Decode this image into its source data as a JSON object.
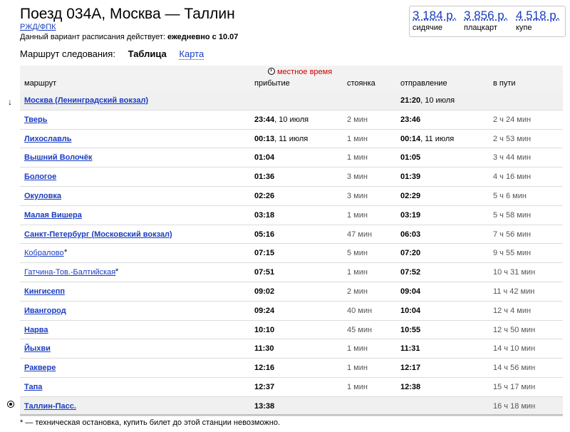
{
  "header": {
    "title": "Поезд 034А, Москва — Таллин",
    "carrier": "РЖД/ФПК",
    "validity_label": "Данный вариант расписания действует:",
    "validity_value": "ежедневно с 10.07"
  },
  "prices": [
    {
      "amount": "3 184 р.",
      "class": "сидячие"
    },
    {
      "amount": "3 856 р.",
      "class": "плацкарт"
    },
    {
      "amount": "4 518 р.",
      "class": "купе"
    }
  ],
  "route_view": {
    "label": "Маршрут следования:",
    "tab_table": "Таблица",
    "tab_map": "Карта"
  },
  "table": {
    "local_time_note": "местное время",
    "columns": {
      "route": "маршрут",
      "arrival": "прибытие",
      "stop": "стоянка",
      "departure": "отправление",
      "travel": "в пути"
    },
    "rows": [
      {
        "station": "Москва (Ленинградский вокзал)",
        "mark": "",
        "bold": true,
        "highlight": true,
        "arr_time": "",
        "arr_date": "",
        "stop": "",
        "dep_time": "21:20",
        "dep_date": ", 10 июля",
        "travel": ""
      },
      {
        "station": "Тверь",
        "mark": "",
        "bold": true,
        "highlight": false,
        "arr_time": "23:44",
        "arr_date": ", 10 июля",
        "stop": "2 мин",
        "dep_time": "23:46",
        "dep_date": "",
        "travel": "2 ч 24 мин"
      },
      {
        "station": "Лихославль",
        "mark": "",
        "bold": true,
        "highlight": false,
        "arr_time": "00:13",
        "arr_date": ", 11 июля",
        "stop": "1 мин",
        "dep_time": "00:14",
        "dep_date": ", 11 июля",
        "travel": "2 ч 53 мин"
      },
      {
        "station": "Вышний Волочёк",
        "mark": "",
        "bold": true,
        "highlight": false,
        "arr_time": "01:04",
        "arr_date": "",
        "stop": "1 мин",
        "dep_time": "01:05",
        "dep_date": "",
        "travel": "3 ч 44 мин"
      },
      {
        "station": "Бологое",
        "mark": "",
        "bold": true,
        "highlight": false,
        "arr_time": "01:36",
        "arr_date": "",
        "stop": "3 мин",
        "dep_time": "01:39",
        "dep_date": "",
        "travel": "4 ч 16 мин"
      },
      {
        "station": "Окуловка",
        "mark": "",
        "bold": true,
        "highlight": false,
        "arr_time": "02:26",
        "arr_date": "",
        "stop": "3 мин",
        "dep_time": "02:29",
        "dep_date": "",
        "travel": "5 ч 6 мин"
      },
      {
        "station": "Малая Вишера",
        "mark": "",
        "bold": true,
        "highlight": false,
        "arr_time": "03:18",
        "arr_date": "",
        "stop": "1 мин",
        "dep_time": "03:19",
        "dep_date": "",
        "travel": "5 ч 58 мин"
      },
      {
        "station": "Санкт-Петербург (Московский вокзал)",
        "mark": "",
        "bold": true,
        "highlight": false,
        "arr_time": "05:16",
        "arr_date": "",
        "stop": "47 мин",
        "dep_time": "06:03",
        "dep_date": "",
        "travel": "7 ч 56 мин"
      },
      {
        "station": "Кобралово",
        "mark": "*",
        "bold": false,
        "highlight": false,
        "arr_time": "07:15",
        "arr_date": "",
        "stop": "5 мин",
        "dep_time": "07:20",
        "dep_date": "",
        "travel": "9 ч 55 мин"
      },
      {
        "station": "Гатчина-Тов.-Балтийская",
        "mark": "*",
        "bold": false,
        "highlight": false,
        "arr_time": "07:51",
        "arr_date": "",
        "stop": "1 мин",
        "dep_time": "07:52",
        "dep_date": "",
        "travel": "10 ч 31 мин"
      },
      {
        "station": "Кингисепп",
        "mark": "",
        "bold": true,
        "highlight": false,
        "arr_time": "09:02",
        "arr_date": "",
        "stop": "2 мин",
        "dep_time": "09:04",
        "dep_date": "",
        "travel": "11 ч 42 мин"
      },
      {
        "station": "Ивангород",
        "mark": "",
        "bold": true,
        "highlight": false,
        "arr_time": "09:24",
        "arr_date": "",
        "stop": "40 мин",
        "dep_time": "10:04",
        "dep_date": "",
        "travel": "12 ч 4 мин"
      },
      {
        "station": "Нарва",
        "mark": "",
        "bold": true,
        "highlight": false,
        "arr_time": "10:10",
        "arr_date": "",
        "stop": "45 мин",
        "dep_time": "10:55",
        "dep_date": "",
        "travel": "12 ч 50 мин"
      },
      {
        "station": "Йыхви",
        "mark": "",
        "bold": true,
        "highlight": false,
        "arr_time": "11:30",
        "arr_date": "",
        "stop": "1 мин",
        "dep_time": "11:31",
        "dep_date": "",
        "travel": "14 ч 10 мин"
      },
      {
        "station": "Раквере",
        "mark": "",
        "bold": true,
        "highlight": false,
        "arr_time": "12:16",
        "arr_date": "",
        "stop": "1 мин",
        "dep_time": "12:17",
        "dep_date": "",
        "travel": "14 ч 56 мин"
      },
      {
        "station": "Тапа",
        "mark": "",
        "bold": true,
        "highlight": false,
        "arr_time": "12:37",
        "arr_date": "",
        "stop": "1 мин",
        "dep_time": "12:38",
        "dep_date": "",
        "travel": "15 ч 17 мин"
      },
      {
        "station": "Таллин-Пасс.",
        "mark": "",
        "bold": true,
        "highlight": true,
        "arr_time": "13:38",
        "arr_date": "",
        "stop": "",
        "dep_time": "",
        "dep_date": "",
        "travel": "16 ч 18 мин"
      }
    ]
  },
  "footnote": "* — техническая остановка, купить билет до этой станции невозможно.",
  "icons": {
    "start": "route-start-arrow-icon",
    "end": "route-end-target-icon",
    "clock": "clock-icon"
  },
  "colors": {
    "link": "#1a3dc1",
    "local_time": "#cc0000",
    "highlight_row": "#f0f0f0"
  }
}
